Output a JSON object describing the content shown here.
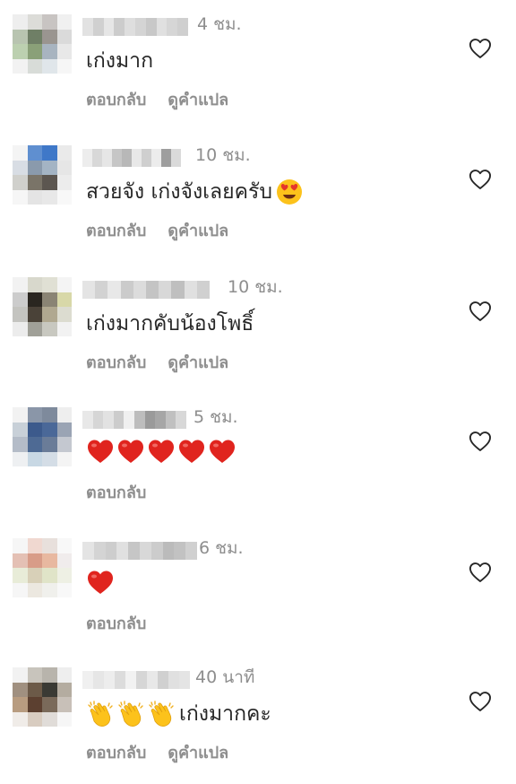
{
  "comments": [
    {
      "username": "",
      "time": "4 ชม.",
      "text": "เก่งมาก",
      "reply_label": "ตอบกลับ",
      "translate_label": "ดูคำแปล",
      "avatar_colors": [
        "#eeeeee",
        "#dcdcd8",
        "#c8c4c2",
        "#f0f0f0",
        "#b8c4b0",
        "#6f7f66",
        "#9a9590",
        "#dadada",
        "#bcd0b0",
        "#8aa078",
        "#a8b4c0",
        "#e8e8e8",
        "#f2f2f2",
        "#d8dcd8",
        "#e0e6ea",
        "#f6f6f6"
      ],
      "username_colors": [
        "#e2e2e2",
        "#d0d0d0",
        "#e6e6e6",
        "#cccccc",
        "#dedede",
        "#d4d4d4",
        "#c8c8c8",
        "#e0e0e0",
        "#d6d6d6",
        "#cfcfcf"
      ]
    },
    {
      "username": "",
      "time": "10 ชม.",
      "text": "สวยจัง เก่งจังเลยครับ",
      "emoji": "heart-eyes",
      "reply_label": "ตอบกลับ",
      "translate_label": "ดูคำแปล",
      "avatar_colors": [
        "#f4f4f4",
        "#5f8fd0",
        "#3f78c8",
        "#eaeaea",
        "#d8dde4",
        "#8a9aac",
        "#a4b4c4",
        "#e6e6e6",
        "#d0d0cc",
        "#7a7468",
        "#5c5650",
        "#ececec",
        "#f6f6f6",
        "#e4e4e4",
        "#e8e8e8",
        "#f8f8f8"
      ],
      "username_colors": [
        "#ededed",
        "#d8d8d8",
        "#e6e6e6",
        "#c6c6c6",
        "#b8b8b8",
        "#e8e8e8",
        "#cfcfcf",
        "#ececec",
        "#9e9e9e",
        "#dadada"
      ]
    },
    {
      "username": "",
      "time": "10 ชม.",
      "text": "เก่งมากคับน้องโพธิ์",
      "reply_label": "ตอบกลับ",
      "translate_label": "ดูคำแปล",
      "avatar_colors": [
        "#f2f2f2",
        "#d8d8cc",
        "#e0e0d4",
        "#f4f4f4",
        "#cccccc",
        "#2a2620",
        "#8a8474",
        "#d8d8a8",
        "#c4c4c0",
        "#4a4238",
        "#b0a890",
        "#dcdcd0",
        "#ececec",
        "#a0a098",
        "#c8c8c0",
        "#f2f2f2"
      ],
      "username_colors": [
        "#e4e4e4",
        "#d2d2d2",
        "#e8e8e8",
        "#cbcbcb",
        "#dcdcdc",
        "#c4c4c4",
        "#d8d8d8",
        "#bfbfbf",
        "#e0e0e0",
        "#d0d0d0"
      ]
    },
    {
      "username": "",
      "time": "5 ชม.",
      "text": "",
      "emoji": "red-hearts",
      "emoji_count": 5,
      "reply_label": "ตอบกลับ",
      "translate_label": "",
      "avatar_colors": [
        "#f2f2f2",
        "#8a96a8",
        "#7e8a9c",
        "#eeeeee",
        "#c8d0d8",
        "#3c5a8c",
        "#4a6898",
        "#9aa4b4",
        "#b4bcc8",
        "#4e6a94",
        "#6a7c98",
        "#c4c8d0",
        "#eef0f2",
        "#c8d8e4",
        "#d4dde6",
        "#f4f4f4"
      ],
      "username_colors": [
        "#e8e8e8",
        "#d6d6d6",
        "#e2e2e2",
        "#cccccc",
        "#f0f0f0",
        "#bdbdbd",
        "#9a9a9a",
        "#a6a6a6",
        "#c0c0c0",
        "#d8d8d8"
      ]
    },
    {
      "username": "",
      "time": "6 ชม.",
      "text": "",
      "emoji": "red-hearts",
      "emoji_count": 1,
      "reply_label": "ตอบกลับ",
      "translate_label": "",
      "avatar_colors": [
        "#f6f6f6",
        "#f0d8d0",
        "#e8e0dc",
        "#f8f8f8",
        "#e4c0b4",
        "#d89c88",
        "#e8b8a0",
        "#f0ecec",
        "#e8ecd8",
        "#d8d0b8",
        "#e0e4c8",
        "#eef0e4",
        "#f6f6f6",
        "#ece8e0",
        "#f0f0ec",
        "#f8f8f8"
      ],
      "username_colors": [
        "#e4e4e4",
        "#d4d4d4",
        "#cdcdcd",
        "#e0e0e0",
        "#c6c6c6",
        "#d8d8d8",
        "#cccccc",
        "#bbbbbb",
        "#c2c2c2",
        "#d0d0d0"
      ]
    },
    {
      "username": "",
      "time": "40 นาที",
      "text": "เก่งมากคะ",
      "emoji": "clapping-hands",
      "emoji_count": 3,
      "reply_label": "ตอบกลับ",
      "translate_label": "ดูคำแปล",
      "avatar_colors": [
        "#f2f2f2",
        "#c8c4bc",
        "#b8b4ac",
        "#eeeeee",
        "#a09080",
        "#6c5a48",
        "#3a3a34",
        "#b4aca0",
        "#b89c80",
        "#5c4030",
        "#7a6a5a",
        "#c8c0b8",
        "#f0ece8",
        "#d8ccc0",
        "#e0dcd8",
        "#f6f6f6"
      ],
      "username_colors": [
        "#f0f0f0",
        "#e6e6e6",
        "#ededed",
        "#dcdcdc",
        "#f2f2f2",
        "#d6d6d6",
        "#e8e8e8",
        "#d0d0d0",
        "#e0e0e0",
        "#e4e4e4"
      ]
    }
  ]
}
